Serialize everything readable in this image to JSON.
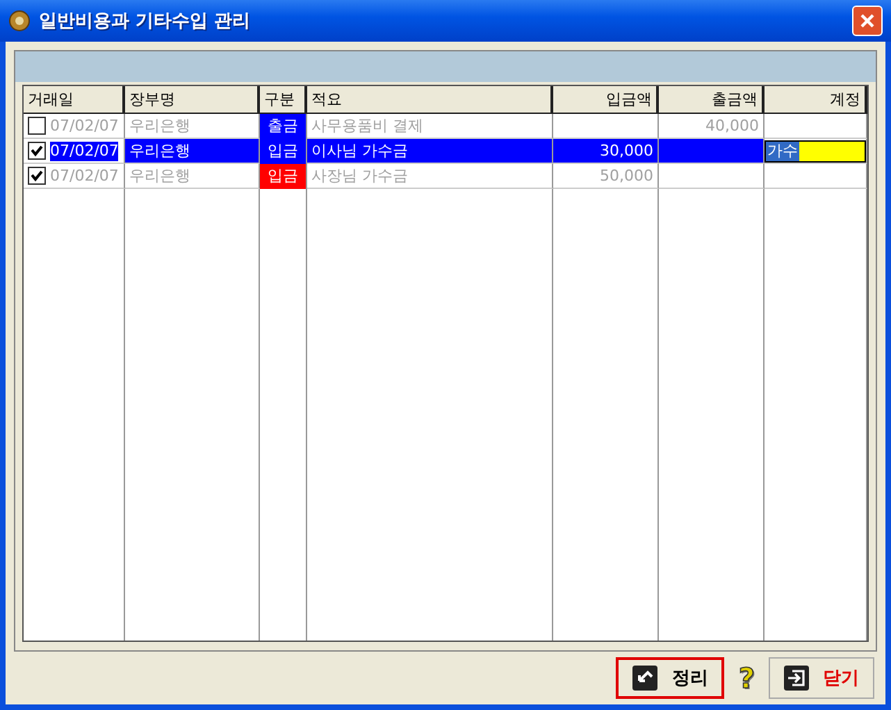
{
  "window": {
    "title": "일반비용과 기타수입 관리"
  },
  "table": {
    "columns": [
      "거래일",
      "장부명",
      "구분",
      "적요",
      "입금액",
      "출금액",
      "계정"
    ],
    "rows": [
      {
        "checked": false,
        "selected": false,
        "date": "07/02/07",
        "book": "우리은행",
        "type": "출금",
        "color": "#0000ff",
        "memo": "사무용품비 결제",
        "deposit": "",
        "withdrawal": "40,000",
        "account": ""
      },
      {
        "checked": true,
        "selected": true,
        "date": "07/02/07",
        "book": "우리은행",
        "type": "입금",
        "color": "#0000ff",
        "memo": "이사님 가수금",
        "deposit": "30,000",
        "withdrawal": "",
        "account": "가수"
      },
      {
        "checked": true,
        "selected": false,
        "date": "07/02/07",
        "book": "우리은행",
        "type": "입금",
        "color": "#ff0000",
        "memo": "사장님 가수금",
        "deposit": "50,000",
        "withdrawal": "",
        "account": ""
      }
    ]
  },
  "buttons": [
    {
      "kind": "action",
      "label": "정리",
      "focused": true
    },
    {
      "kind": "help",
      "label": "?"
    },
    {
      "kind": "close",
      "label": "닫기",
      "focused": false
    }
  ]
}
